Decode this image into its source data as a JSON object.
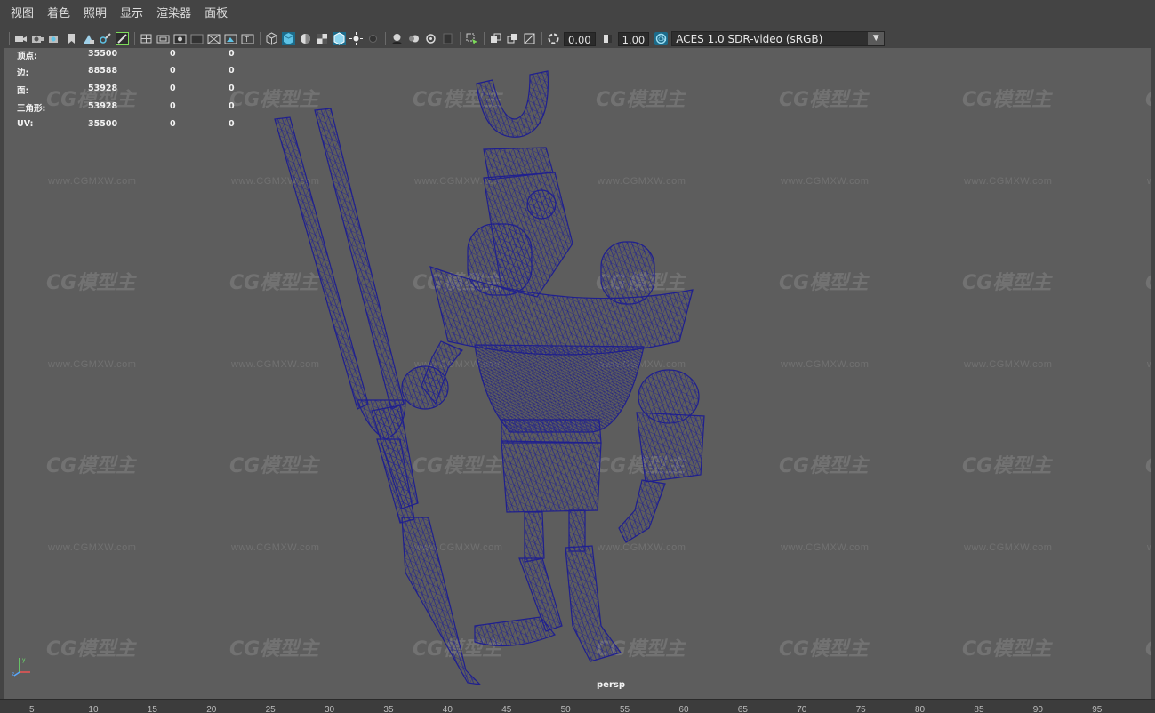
{
  "menubar": {
    "items": [
      "视图",
      "着色",
      "照明",
      "显示",
      "渲染器",
      "面板"
    ]
  },
  "toolbar": {
    "exposure_value": "0.00",
    "gamma_value": "1.00",
    "color_space": "ACES 1.0 SDR-video (sRGB)",
    "icons": [
      "camera-select-icon",
      "camera-attributes-icon",
      "bookmark-icon",
      "image-plane-icon",
      "grease-pencil-icon",
      "2d-pan-zoom-icon",
      "grid-icon",
      "film-gate-icon",
      "resolution-gate-icon",
      "gate-mask-icon",
      "field-chart-icon",
      "safe-action-icon",
      "safe-title-icon",
      "wireframe-icon",
      "smooth-shade-icon",
      "default-material-icon",
      "textured-icon",
      "wireframe-on-shaded-icon",
      "use-all-lights-icon",
      "shadows-icon",
      "screen-space-ao-icon",
      "motion-blur-icon",
      "antialiasing-icon",
      "depth-of-field-icon",
      "isolate-select-icon",
      "xray-icon",
      "xray-active-icon",
      "xray-joints-icon",
      "exposure-icon",
      "gamma-icon",
      "color-management-icon"
    ]
  },
  "hud": {
    "rows": [
      {
        "label": "顶点:",
        "v1": "35500",
        "v2": "0",
        "v3": "0"
      },
      {
        "label": "边:",
        "v1": "88588",
        "v2": "0",
        "v3": "0"
      },
      {
        "label": "面:",
        "v1": "53928",
        "v2": "0",
        "v3": "0"
      },
      {
        "label": "三角形:",
        "v1": "53928",
        "v2": "0",
        "v3": "0"
      },
      {
        "label": "UV:",
        "v1": "35500",
        "v2": "0",
        "v3": "0"
      }
    ]
  },
  "viewport": {
    "camera_label": "persp",
    "watermark_logo": "CG模型主",
    "watermark_url": "www.CGMXW.com",
    "wire_color": "#1f1f8f",
    "background_color": "#5d5d5d"
  },
  "timeline": {
    "ticks": [
      "5",
      "10",
      "15",
      "20",
      "25",
      "30",
      "35",
      "40",
      "45",
      "50",
      "55",
      "60",
      "65",
      "70",
      "75",
      "80",
      "85",
      "90",
      "95"
    ]
  },
  "colors": {
    "ui_dark": "#444444",
    "accent_cyan": "#5ec3e6",
    "accent_green": "#7ddc5a"
  }
}
